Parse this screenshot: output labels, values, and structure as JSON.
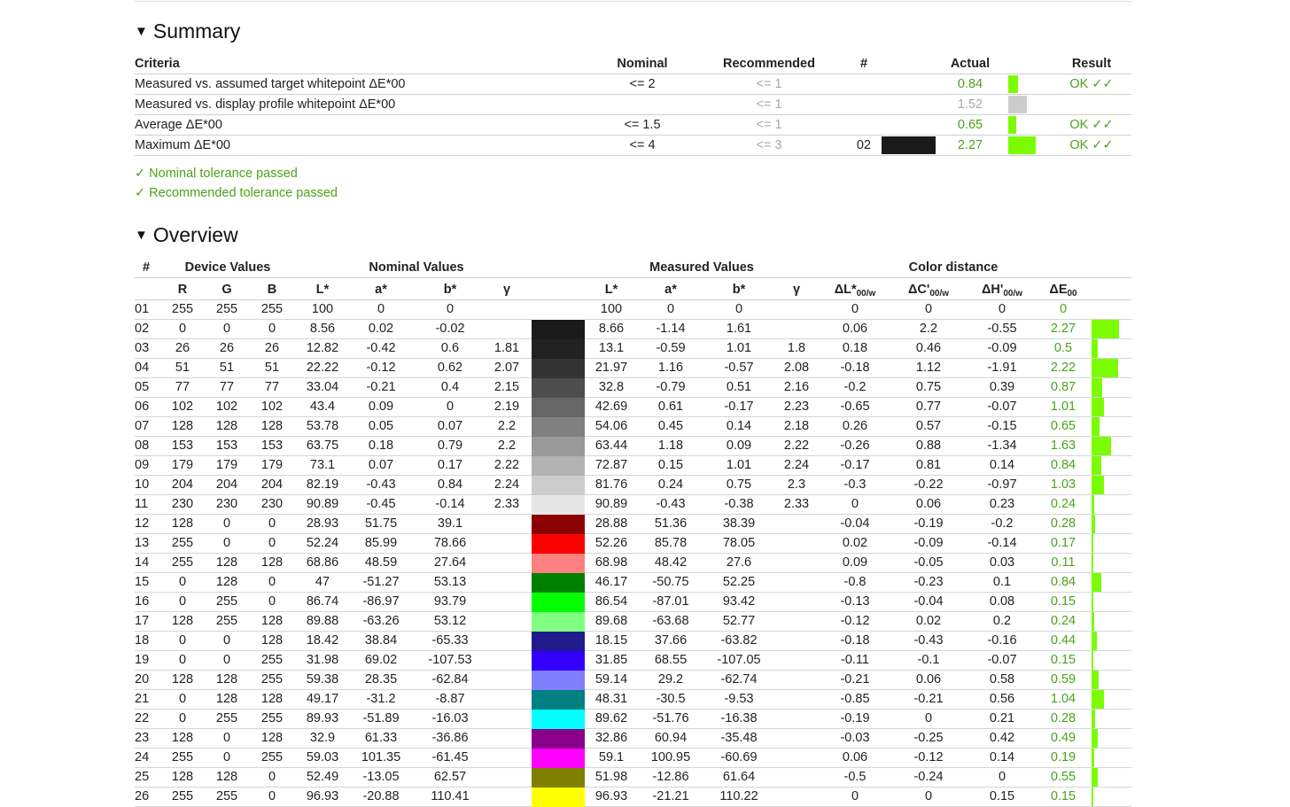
{
  "summary": {
    "title": "Summary",
    "headers": {
      "criteria": "Criteria",
      "nominal": "Nominal",
      "recommended": "Recommended",
      "num": "#",
      "actual": "Actual",
      "result": "Result"
    },
    "rows": [
      {
        "criteria": "Measured vs. assumed target whitepoint ΔE*00",
        "nominal": "<= 2",
        "recommended": "<= 1",
        "num": "",
        "actual": "0.84",
        "result": "OK ✓✓",
        "bar_color": "#7cfc00",
        "bar_value": 0.84,
        "actual_color": "#4aa318"
      },
      {
        "criteria": "Measured vs. display profile whitepoint ΔE*00",
        "nominal": "",
        "recommended": "<= 1",
        "num": "",
        "actual": "1.52",
        "result": "",
        "bar_color": "#cccccc",
        "bar_value": 1.52,
        "actual_color": "#a8a8a8"
      },
      {
        "criteria": "Average ΔE*00",
        "nominal": "<= 1.5",
        "recommended": "<= 1",
        "num": "",
        "actual": "0.65",
        "result": "OK ✓✓",
        "bar_color": "#7cfc00",
        "bar_value": 0.65,
        "actual_color": "#4aa318"
      },
      {
        "criteria": "Maximum ΔE*00",
        "nominal": "<= 4",
        "recommended": "<= 3",
        "num": "02",
        "actual": "2.27",
        "result": "OK ✓✓",
        "bar_color": "#7cfc00",
        "bar_value": 2.27,
        "actual_color": "#4aa318",
        "swatch": "#1a1a1a"
      }
    ],
    "passed": [
      "✓ Nominal tolerance passed",
      "✓ Recommended tolerance passed"
    ]
  },
  "overview": {
    "title": "Overview",
    "group_headers": {
      "num": "#",
      "device": "Device Values",
      "nominal": "Nominal Values",
      "measured": "Measured Values",
      "distance": "Color distance"
    },
    "sub_headers": {
      "r": "R",
      "g": "G",
      "b": "B",
      "nl": "L*",
      "na": "a*",
      "nb": "b*",
      "ng": "γ",
      "ml": "L*",
      "ma": "a*",
      "mb": "b*",
      "mg": "γ",
      "dl": "ΔL*",
      "dc": "ΔC'",
      "dh": "ΔH'",
      "de": "ΔE",
      "dl_sub": "00/w",
      "dc_sub": "00/w",
      "dh_sub": "00/w",
      "de_sub": "00"
    },
    "rows": [
      {
        "n": "01",
        "r": "255",
        "g": "255",
        "b": "255",
        "nl": "100",
        "na": "0",
        "nb": "0",
        "ng": "",
        "sw": "#ffffff",
        "ml": "100",
        "ma": "0",
        "mb": "0",
        "mg": "",
        "dl": "0",
        "dc": "0",
        "dh": "0",
        "de": "0"
      },
      {
        "n": "02",
        "r": "0",
        "g": "0",
        "b": "0",
        "nl": "8.56",
        "na": "0.02",
        "nb": "-0.02",
        "ng": "",
        "sw": "#1a1a1a",
        "ml": "8.66",
        "ma": "-1.14",
        "mb": "1.61",
        "mg": "",
        "dl": "0.06",
        "dc": "2.2",
        "dh": "-0.55",
        "de": "2.27"
      },
      {
        "n": "03",
        "r": "26",
        "g": "26",
        "b": "26",
        "nl": "12.82",
        "na": "-0.42",
        "nb": "0.6",
        "ng": "1.81",
        "sw": "#222222",
        "ml": "13.1",
        "ma": "-0.59",
        "mb": "1.01",
        "mg": "1.8",
        "dl": "0.18",
        "dc": "0.46",
        "dh": "-0.09",
        "de": "0.5"
      },
      {
        "n": "04",
        "r": "51",
        "g": "51",
        "b": "51",
        "nl": "22.22",
        "na": "-0.12",
        "nb": "0.62",
        "ng": "2.07",
        "sw": "#333333",
        "ml": "21.97",
        "ma": "1.16",
        "mb": "-0.57",
        "mg": "2.08",
        "dl": "-0.18",
        "dc": "1.12",
        "dh": "-1.91",
        "de": "2.22"
      },
      {
        "n": "05",
        "r": "77",
        "g": "77",
        "b": "77",
        "nl": "33.04",
        "na": "-0.21",
        "nb": "0.4",
        "ng": "2.15",
        "sw": "#4d4d4d",
        "ml": "32.8",
        "ma": "-0.79",
        "mb": "0.51",
        "mg": "2.16",
        "dl": "-0.2",
        "dc": "0.75",
        "dh": "0.39",
        "de": "0.87"
      },
      {
        "n": "06",
        "r": "102",
        "g": "102",
        "b": "102",
        "nl": "43.4",
        "na": "0.09",
        "nb": "0",
        "ng": "2.19",
        "sw": "#666666",
        "ml": "42.69",
        "ma": "0.61",
        "mb": "-0.17",
        "mg": "2.23",
        "dl": "-0.65",
        "dc": "0.77",
        "dh": "-0.07",
        "de": "1.01"
      },
      {
        "n": "07",
        "r": "128",
        "g": "128",
        "b": "128",
        "nl": "53.78",
        "na": "0.05",
        "nb": "0.07",
        "ng": "2.2",
        "sw": "#808080",
        "ml": "54.06",
        "ma": "0.45",
        "mb": "0.14",
        "mg": "2.18",
        "dl": "0.26",
        "dc": "0.57",
        "dh": "-0.15",
        "de": "0.65"
      },
      {
        "n": "08",
        "r": "153",
        "g": "153",
        "b": "153",
        "nl": "63.75",
        "na": "0.18",
        "nb": "0.79",
        "ng": "2.2",
        "sw": "#999999",
        "ml": "63.44",
        "ma": "1.18",
        "mb": "0.09",
        "mg": "2.22",
        "dl": "-0.26",
        "dc": "0.88",
        "dh": "-1.34",
        "de": "1.63"
      },
      {
        "n": "09",
        "r": "179",
        "g": "179",
        "b": "179",
        "nl": "73.1",
        "na": "0.07",
        "nb": "0.17",
        "ng": "2.22",
        "sw": "#b3b3b3",
        "ml": "72.87",
        "ma": "0.15",
        "mb": "1.01",
        "mg": "2.24",
        "dl": "-0.17",
        "dc": "0.81",
        "dh": "0.14",
        "de": "0.84"
      },
      {
        "n": "10",
        "r": "204",
        "g": "204",
        "b": "204",
        "nl": "82.19",
        "na": "-0.43",
        "nb": "0.84",
        "ng": "2.24",
        "sw": "#cccccc",
        "ml": "81.76",
        "ma": "0.24",
        "mb": "0.75",
        "mg": "2.3",
        "dl": "-0.3",
        "dc": "-0.22",
        "dh": "-0.97",
        "de": "1.03"
      },
      {
        "n": "11",
        "r": "230",
        "g": "230",
        "b": "230",
        "nl": "90.89",
        "na": "-0.45",
        "nb": "-0.14",
        "ng": "2.33",
        "sw": "#e6e6e6",
        "ml": "90.89",
        "ma": "-0.43",
        "mb": "-0.38",
        "mg": "2.33",
        "dl": "0",
        "dc": "0.06",
        "dh": "0.23",
        "de": "0.24"
      },
      {
        "n": "12",
        "r": "128",
        "g": "0",
        "b": "0",
        "nl": "28.93",
        "na": "51.75",
        "nb": "39.1",
        "ng": "",
        "sw": "#8b0000",
        "ml": "28.88",
        "ma": "51.36",
        "mb": "38.39",
        "mg": "",
        "dl": "-0.04",
        "dc": "-0.19",
        "dh": "-0.2",
        "de": "0.28"
      },
      {
        "n": "13",
        "r": "255",
        "g": "0",
        "b": "0",
        "nl": "52.24",
        "na": "85.99",
        "nb": "78.66",
        "ng": "",
        "sw": "#ff0000",
        "ml": "52.26",
        "ma": "85.78",
        "mb": "78.05",
        "mg": "",
        "dl": "0.02",
        "dc": "-0.09",
        "dh": "-0.14",
        "de": "0.17"
      },
      {
        "n": "14",
        "r": "255",
        "g": "128",
        "b": "128",
        "nl": "68.86",
        "na": "48.59",
        "nb": "27.64",
        "ng": "",
        "sw": "#ff8080",
        "ml": "68.98",
        "ma": "48.42",
        "mb": "27.6",
        "mg": "",
        "dl": "0.09",
        "dc": "-0.05",
        "dh": "0.03",
        "de": "0.11"
      },
      {
        "n": "15",
        "r": "0",
        "g": "128",
        "b": "0",
        "nl": "47",
        "na": "-51.27",
        "nb": "53.13",
        "ng": "",
        "sw": "#008000",
        "ml": "46.17",
        "ma": "-50.75",
        "mb": "52.25",
        "mg": "",
        "dl": "-0.8",
        "dc": "-0.23",
        "dh": "0.1",
        "de": "0.84"
      },
      {
        "n": "16",
        "r": "0",
        "g": "255",
        "b": "0",
        "nl": "86.74",
        "na": "-86.97",
        "nb": "93.79",
        "ng": "",
        "sw": "#00ff00",
        "ml": "86.54",
        "ma": "-87.01",
        "mb": "93.42",
        "mg": "",
        "dl": "-0.13",
        "dc": "-0.04",
        "dh": "0.08",
        "de": "0.15"
      },
      {
        "n": "17",
        "r": "128",
        "g": "255",
        "b": "128",
        "nl": "89.88",
        "na": "-63.26",
        "nb": "53.12",
        "ng": "",
        "sw": "#80ff80",
        "ml": "89.68",
        "ma": "-63.68",
        "mb": "52.77",
        "mg": "",
        "dl": "-0.12",
        "dc": "0.02",
        "dh": "0.2",
        "de": "0.24"
      },
      {
        "n": "18",
        "r": "0",
        "g": "0",
        "b": "128",
        "nl": "18.42",
        "na": "38.84",
        "nb": "-65.33",
        "ng": "",
        "sw": "#201a8c",
        "ml": "18.15",
        "ma": "37.66",
        "mb": "-63.82",
        "mg": "",
        "dl": "-0.18",
        "dc": "-0.43",
        "dh": "-0.16",
        "de": "0.44"
      },
      {
        "n": "19",
        "r": "0",
        "g": "0",
        "b": "255",
        "nl": "31.98",
        "na": "69.02",
        "nb": "-107.53",
        "ng": "",
        "sw": "#3300ff",
        "ml": "31.85",
        "ma": "68.55",
        "mb": "-107.05",
        "mg": "",
        "dl": "-0.11",
        "dc": "-0.1",
        "dh": "-0.07",
        "de": "0.15"
      },
      {
        "n": "20",
        "r": "128",
        "g": "128",
        "b": "255",
        "nl": "59.38",
        "na": "28.35",
        "nb": "-62.84",
        "ng": "",
        "sw": "#8080ff",
        "ml": "59.14",
        "ma": "29.2",
        "mb": "-62.74",
        "mg": "",
        "dl": "-0.21",
        "dc": "0.06",
        "dh": "0.58",
        "de": "0.59"
      },
      {
        "n": "21",
        "r": "0",
        "g": "128",
        "b": "128",
        "nl": "49.17",
        "na": "-31.2",
        "nb": "-8.87",
        "ng": "",
        "sw": "#008080",
        "ml": "48.31",
        "ma": "-30.5",
        "mb": "-9.53",
        "mg": "",
        "dl": "-0.85",
        "dc": "-0.21",
        "dh": "0.56",
        "de": "1.04"
      },
      {
        "n": "22",
        "r": "0",
        "g": "255",
        "b": "255",
        "nl": "89.93",
        "na": "-51.89",
        "nb": "-16.03",
        "ng": "",
        "sw": "#00ffff",
        "ml": "89.62",
        "ma": "-51.76",
        "mb": "-16.38",
        "mg": "",
        "dl": "-0.19",
        "dc": "0",
        "dh": "0.21",
        "de": "0.28"
      },
      {
        "n": "23",
        "r": "128",
        "g": "0",
        "b": "128",
        "nl": "32.9",
        "na": "61.33",
        "nb": "-36.86",
        "ng": "",
        "sw": "#8b008b",
        "ml": "32.86",
        "ma": "60.94",
        "mb": "-35.48",
        "mg": "",
        "dl": "-0.03",
        "dc": "-0.25",
        "dh": "0.42",
        "de": "0.49"
      },
      {
        "n": "24",
        "r": "255",
        "g": "0",
        "b": "255",
        "nl": "59.03",
        "na": "101.35",
        "nb": "-61.45",
        "ng": "",
        "sw": "#ff00ff",
        "ml": "59.1",
        "ma": "100.95",
        "mb": "-60.69",
        "mg": "",
        "dl": "0.06",
        "dc": "-0.12",
        "dh": "0.14",
        "de": "0.19"
      },
      {
        "n": "25",
        "r": "128",
        "g": "128",
        "b": "0",
        "nl": "52.49",
        "na": "-13.05",
        "nb": "62.57",
        "ng": "",
        "sw": "#808000",
        "ml": "51.98",
        "ma": "-12.86",
        "mb": "61.64",
        "mg": "",
        "dl": "-0.5",
        "dc": "-0.24",
        "dh": "0",
        "de": "0.55"
      },
      {
        "n": "26",
        "r": "255",
        "g": "255",
        "b": "0",
        "nl": "96.93",
        "na": "-20.88",
        "nb": "110.41",
        "ng": "",
        "sw": "#ffff00",
        "ml": "96.93",
        "ma": "-21.21",
        "mb": "110.22",
        "mg": "",
        "dl": "0",
        "dc": "0",
        "dh": "0.15",
        "de": "0.15"
      }
    ]
  },
  "colors": {
    "pass_green": "#4aa318",
    "bar_green": "#7cfc00",
    "muted_gray": "#a8a8a8"
  }
}
